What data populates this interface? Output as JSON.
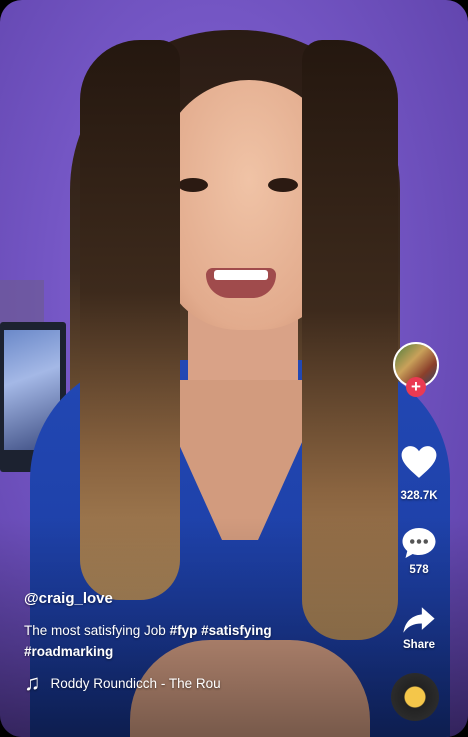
{
  "post": {
    "username": "@craig_love",
    "description_text": "The most satisfying Job ",
    "hashtags": [
      "#fyp",
      "#satisfying",
      "#roadmarking"
    ],
    "song": "Roddy Roundicch - The Rou"
  },
  "actions": {
    "likes": "328.7K",
    "comments": "578",
    "share_label": "Share"
  },
  "icons": {
    "like": "heart-icon",
    "comment": "comment-bubble-icon",
    "share": "share-arrow-icon",
    "music": "music-note-icon",
    "follow": "plus-icon"
  },
  "colors": {
    "follow_badge": "#ea3a52",
    "text": "#ffffff",
    "disc_center": "#f4c64a"
  }
}
